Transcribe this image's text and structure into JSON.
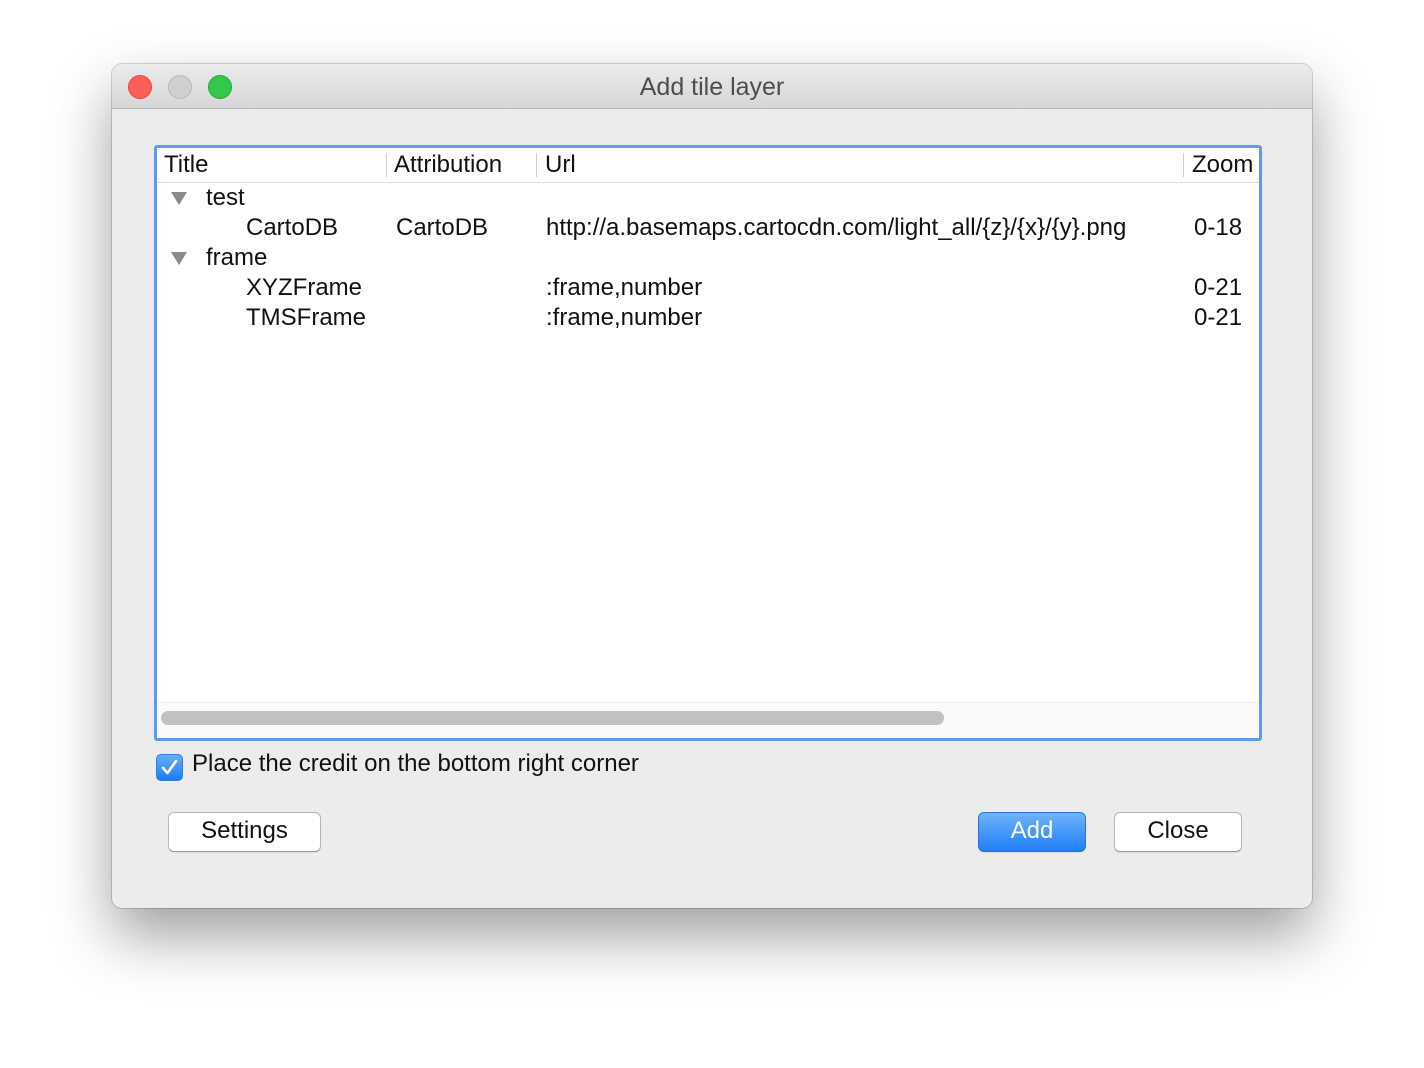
{
  "window": {
    "title": "Add tile layer"
  },
  "table": {
    "columns": [
      "Title",
      "Attribution",
      "Url",
      "Zoom"
    ],
    "groups": [
      {
        "name": "test",
        "expanded": true,
        "rows": [
          {
            "title": "CartoDB",
            "attribution": "CartoDB",
            "url": "http://a.basemaps.cartocdn.com/light_all/{z}/{x}/{y}.png",
            "zoom": "0-18"
          }
        ]
      },
      {
        "name": "frame",
        "expanded": true,
        "rows": [
          {
            "title": "XYZFrame",
            "attribution": "",
            "url": ":frame,number",
            "zoom": "0-21"
          },
          {
            "title": "TMSFrame",
            "attribution": "",
            "url": ":frame,number",
            "zoom": "0-21"
          }
        ]
      }
    ]
  },
  "credit_checkbox": {
    "label": "Place the credit on the bottom right corner",
    "checked": true
  },
  "buttons": {
    "settings": "Settings",
    "add": "Add",
    "close": "Close"
  },
  "colors": {
    "accent": "#1e7ef6",
    "focus_ring": "#5b9cf2",
    "close_light": "#fc5f57",
    "minimize_light": "#d0d0d0",
    "zoom_light": "#34c84a"
  },
  "icons": {
    "disclosure": "disclosure-triangle-down-icon",
    "checkmark": "checkmark-icon"
  }
}
